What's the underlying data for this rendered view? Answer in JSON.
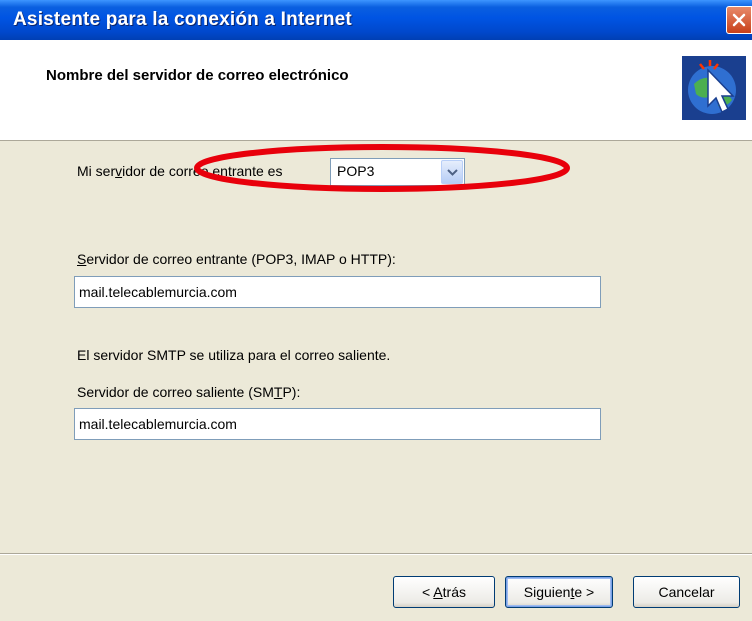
{
  "window": {
    "title": "Asistente para la conexión a Internet",
    "close_icon": "close-icon"
  },
  "header": {
    "title": "Nombre del servidor de correo electrónico",
    "icon": "wizard-cursor-icon"
  },
  "incoming_type": {
    "label_a": "Mi ser",
    "label_u": "v",
    "label_b": "idor de correo entrante es",
    "value": "POP3"
  },
  "incoming_server": {
    "label_u": "S",
    "label_b": "ervidor de correo entrante (POP3, IMAP o HTTP):",
    "value": "mail.telecablemurcia.com"
  },
  "smtp_note": "El servidor SMTP se utiliza para el correo saliente.",
  "outgoing_server": {
    "label_a": "Servidor de correo saliente (SM",
    "label_u": "T",
    "label_b": "P):",
    "value": "mail.telecablemurcia.com"
  },
  "highlight": {
    "color": "#e8000b",
    "shape": "ellipse"
  },
  "buttons": {
    "back_a": "< ",
    "back_u": "A",
    "back_b": "trás",
    "next_a": "Siguien",
    "next_u": "t",
    "next_b": "e >",
    "cancel": "Cancelar"
  },
  "colors": {
    "titlebar": "#0054e3",
    "dialog_bg": "#ece9d8",
    "header_bg": "#ffffff",
    "input_border": "#7f9db9"
  }
}
